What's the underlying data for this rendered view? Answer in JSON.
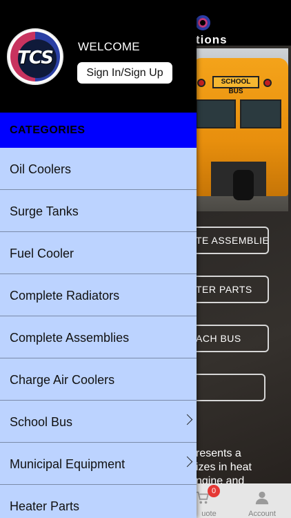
{
  "background": {
    "brand_text": "tions",
    "bus_sign": "SCHOOL BUS",
    "buttons": [
      {
        "label": "TE ASSEMBLIES"
      },
      {
        "label": "TER PARTS"
      },
      {
        "label": "ACH BUS"
      },
      {
        "label": ""
      }
    ],
    "paragraph": "resents a\nizes in heat\nngine and",
    "tabbar": {
      "quote_label": "uote",
      "quote_badge": "0",
      "account_label": "Account"
    }
  },
  "drawer": {
    "logo_text": "TCS",
    "welcome": "WELCOME",
    "signin_label": "Sign In/Sign Up",
    "categories_title": "CATEGORIES",
    "categories_color": "#0000ff",
    "drawer_color": "#bcd3ff",
    "items": [
      {
        "label": "Oil Coolers",
        "has_children": false
      },
      {
        "label": "Surge Tanks",
        "has_children": false
      },
      {
        "label": "Fuel Cooler",
        "has_children": false
      },
      {
        "label": "Complete Radiators",
        "has_children": false
      },
      {
        "label": "Complete Assemblies",
        "has_children": false
      },
      {
        "label": "Charge Air Coolers",
        "has_children": false
      },
      {
        "label": "School Bus",
        "has_children": true
      },
      {
        "label": "Municipal Equipment",
        "has_children": true
      },
      {
        "label": "Heater Parts",
        "has_children": false
      }
    ]
  }
}
